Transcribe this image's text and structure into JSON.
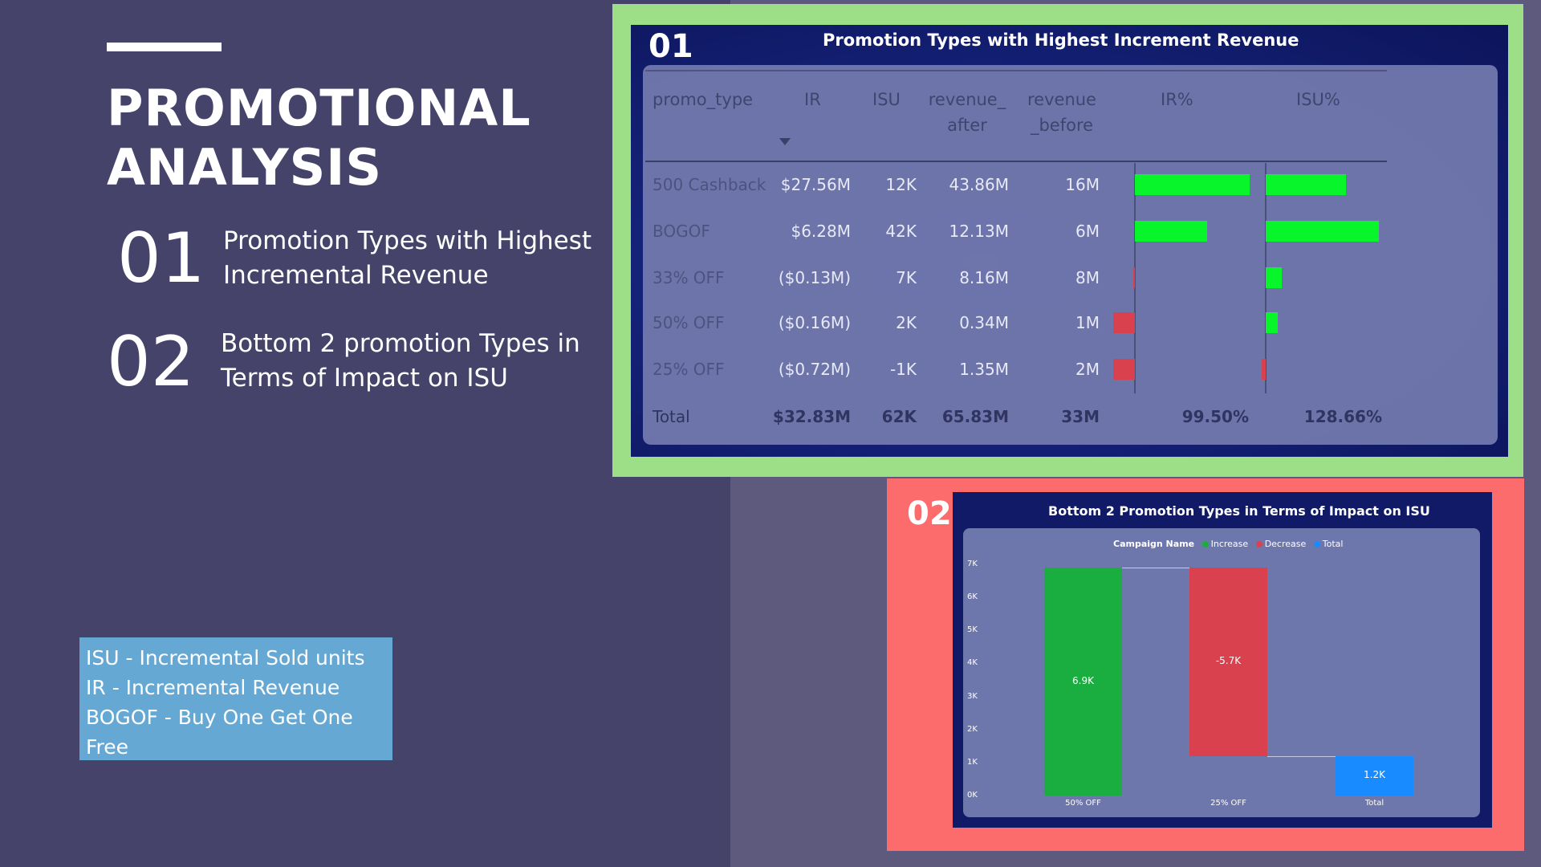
{
  "slide": {
    "title_line1": "PROMOTIONAL",
    "title_line2": "ANALYSIS",
    "agenda": [
      {
        "num": "01",
        "line1": "Promotion Types with Highest",
        "line2": "Incremental Revenue"
      },
      {
        "num": "02",
        "line1": "Bottom 2 promotion Types in",
        "line2": "Terms of Impact on ISU"
      }
    ],
    "glossary": [
      "ISU - Incremental Sold units",
      "IR - Incremental Revenue",
      "BOGOF - Buy One Get One",
      "Free"
    ]
  },
  "panel1": {
    "number": "01",
    "title": "Promotion Types with Highest Increment Revenue",
    "headers": {
      "promo_type": "promo_type",
      "ir": "IR",
      "isu": "ISU",
      "rev_after_1": "revenue_",
      "rev_after_2": "after",
      "rev_before_1": "revenue",
      "rev_before_2": "_before",
      "ir_pct": "IR%",
      "isu_pct": "ISU%",
      "sort_icon": "sort-descending-icon"
    },
    "rows": [
      {
        "promo_type": "500 Cashback",
        "ir": "$27.56M",
        "isu": "12K",
        "revenue_after": "43.86M",
        "revenue_before": "16M",
        "ir_pct_bar": 0.84,
        "isu_pct_bar": 0.59
      },
      {
        "promo_type": "BOGOF",
        "ir": "$6.28M",
        "isu": "42K",
        "revenue_after": "12.13M",
        "revenue_before": "6M",
        "ir_pct_bar": 0.53,
        "isu_pct_bar": 0.83
      },
      {
        "promo_type": "33% OFF",
        "ir": "($0.13M)",
        "isu": "7K",
        "revenue_after": "8.16M",
        "revenue_before": "8M",
        "ir_pct_bar": -0.01,
        "isu_pct_bar": 0.12
      },
      {
        "promo_type": "50% OFF",
        "ir": "($0.16M)",
        "isu": "2K",
        "revenue_after": "0.34M",
        "revenue_before": "1M",
        "ir_pct_bar": -0.16,
        "isu_pct_bar": 0.09
      },
      {
        "promo_type": "25% OFF",
        "ir": "($0.72M)",
        "isu": "-1K",
        "revenue_after": "1.35M",
        "revenue_before": "2M",
        "ir_pct_bar": -0.16,
        "isu_pct_bar": -0.03
      }
    ],
    "total": {
      "label": "Total",
      "ir": "$32.83M",
      "isu": "62K",
      "revenue_after": "65.83M",
      "revenue_before": "33M",
      "ir_pct": "99.50%",
      "isu_pct": "128.66%"
    },
    "colors": {
      "positive": "#07f52a",
      "negative": "#d9414f"
    }
  },
  "panel2": {
    "number": "02",
    "title": "Bottom 2 Promotion Types in Terms of Impact on ISU",
    "legend": {
      "title": "Campaign Name",
      "items": [
        {
          "label": "Increase",
          "color": "#1aad3f"
        },
        {
          "label": "Decrease",
          "color": "#d9414f"
        },
        {
          "label": "Total",
          "color": "#178bff"
        }
      ]
    },
    "y_ticks": [
      "7K",
      "6K",
      "5K",
      "4K",
      "3K",
      "2K",
      "1K",
      "0K"
    ]
  },
  "chart_data": {
    "type": "bar",
    "subtype": "waterfall",
    "title": "Bottom 2 Promotion Types in Terms of Impact on ISU",
    "categories": [
      "50% OFF",
      "25% OFF",
      "Total"
    ],
    "values": [
      6900,
      -5700,
      1200
    ],
    "labels": [
      "6.9K",
      "-5.7K",
      "1.2K"
    ],
    "ylim": [
      0,
      7000
    ],
    "legend": [
      "Increase",
      "Decrease",
      "Total"
    ],
    "legend_position": "top"
  }
}
